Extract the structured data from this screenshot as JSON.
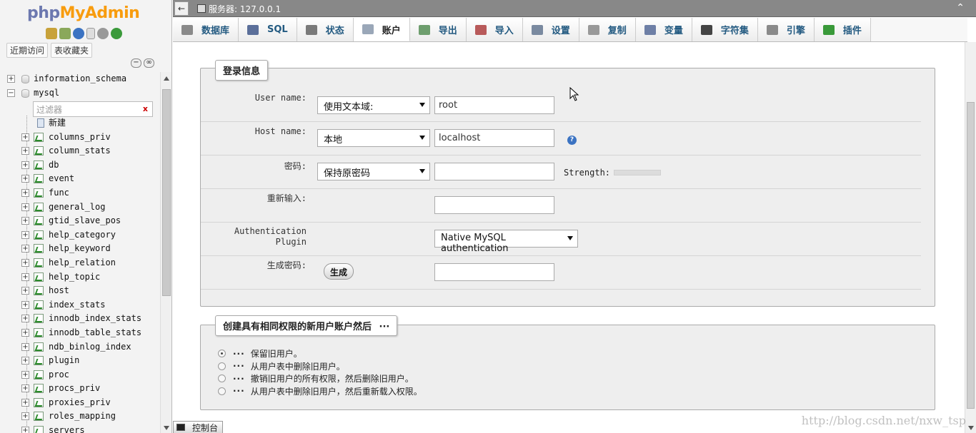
{
  "nav": {
    "logo_php": "php",
    "logo_myadmin": "MyAdmin",
    "icons": [
      "home-icon",
      "logout-icon",
      "help-icon",
      "docs-icon",
      "settings-icon",
      "reload-icon"
    ],
    "tabs": [
      "近期访问",
      "表收藏夹"
    ],
    "filter_placeholder": "过滤器",
    "filter_clear": "x",
    "databases": [
      {
        "name": "information_schema",
        "expander": "+"
      },
      {
        "name": "mysql",
        "expander": "−"
      }
    ],
    "new_label": "新建",
    "tables": [
      "columns_priv",
      "column_stats",
      "db",
      "event",
      "func",
      "general_log",
      "gtid_slave_pos",
      "help_category",
      "help_keyword",
      "help_relation",
      "help_topic",
      "host",
      "index_stats",
      "innodb_index_stats",
      "innodb_table_stats",
      "ndb_binlog_index",
      "plugin",
      "proc",
      "procs_priv",
      "proxies_priv",
      "roles_mapping",
      "servers"
    ]
  },
  "topbar": {
    "back": "←",
    "server_label": "服务器: 127.0.0.1",
    "close": "⌃"
  },
  "tabs": [
    {
      "label": "数据库",
      "icon": "database-icon",
      "color": "#8a8a8a",
      "active": false
    },
    {
      "label": "SQL",
      "icon": "sql-icon",
      "color": "#5b6f9a",
      "active": false
    },
    {
      "label": "状态",
      "icon": "status-icon",
      "color": "#7a7a7a",
      "active": false
    },
    {
      "label": "账户",
      "icon": "users-icon",
      "color": "#9aa7b8",
      "active": true
    },
    {
      "label": "导出",
      "icon": "export-icon",
      "color": "#6e9e6e",
      "active": false
    },
    {
      "label": "导入",
      "icon": "import-icon",
      "color": "#b85a5a",
      "active": false
    },
    {
      "label": "设置",
      "icon": "wrench-icon",
      "color": "#7a8aa0",
      "active": false
    },
    {
      "label": "复制",
      "icon": "replication-icon",
      "color": "#999999",
      "active": false
    },
    {
      "label": "变量",
      "icon": "variables-icon",
      "color": "#6e7fa6",
      "active": false
    },
    {
      "label": "字符集",
      "icon": "charset-icon",
      "color": "#444444",
      "active": false
    },
    {
      "label": "引擎",
      "icon": "engine-icon",
      "color": "#8a8a8a",
      "active": false
    },
    {
      "label": "插件",
      "icon": "plugin-icon",
      "color": "#3a9a3a",
      "active": false
    }
  ],
  "login": {
    "legend": "登录信息",
    "username_label": "User name:",
    "username_select": "使用文本域:",
    "username_value": "root",
    "host_label": "Host name:",
    "host_select": "本地",
    "host_value": "localhost",
    "password_label": "密码:",
    "password_select": "保持原密码",
    "password_value": "",
    "strength_label": "Strength:",
    "retype_label": "重新输入:",
    "retype_value": "",
    "auth_label_1": "Authentication",
    "auth_label_2": "Plugin",
    "auth_select": "Native MySQL authentication",
    "generate_label": "生成密码:",
    "generate_button": "生成",
    "generated_value": ""
  },
  "create": {
    "legend": "创建具有相同权限的新用户账户然后",
    "legend_suffix": "···",
    "options": [
      {
        "dots": "···",
        "label": "保留旧用户。",
        "checked": true
      },
      {
        "dots": "···",
        "label": "从用户表中删除旧用户。",
        "checked": false
      },
      {
        "dots": "···",
        "label": "撤销旧用户的所有权限，然后删除旧用户。",
        "checked": false
      },
      {
        "dots": "···",
        "label": "从用户表中删除旧用户，然后重新载入权限。",
        "checked": false
      }
    ]
  },
  "console": {
    "label": "控制台"
  },
  "watermark": "http://blog.csdn.net/nxw_tsp"
}
